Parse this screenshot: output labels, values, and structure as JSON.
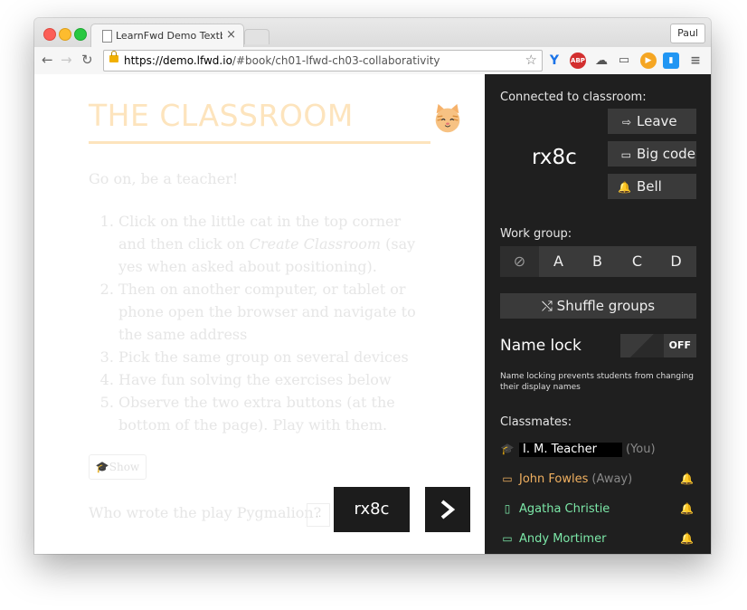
{
  "browser": {
    "tab_title": "LearnFwd Demo Textbook",
    "tab_close": "×",
    "profile_name": "Paul",
    "url_host": "https://demo.lfwd.io",
    "url_path": "/#book/ch01-lfwd-ch03-collaborativity",
    "nav_back": "←",
    "nav_forward": "→",
    "nav_reload": "↻",
    "star": "☆",
    "ext_icons": [
      "vivaldi-v-icon",
      "adblock-plus-icon",
      "cloud-upload-icon",
      "cast-icon",
      "play-icon",
      "toolbox-icon",
      "menu-icon"
    ],
    "ext_labels": {
      "v": "Y",
      "abp": "ABP",
      "cloud": "☁",
      "cast": "▭",
      "play": "▶",
      "tools": "▮",
      "menu": "≡"
    }
  },
  "page": {
    "heading": "THE CLASSROOM",
    "intro": "Go on, be a teacher!",
    "steps": [
      {
        "before": "Click on the little cat in the top corner and then click on ",
        "em": "Create Classroom",
        "after": " (say yes when asked about positioning)."
      },
      {
        "text": "Then on another computer, or tablet or phone open the browser and navigate to the same address"
      },
      {
        "text": "Pick the same group on several devices"
      },
      {
        "text": "Have fun solving the exercises below"
      },
      {
        "text": "Observe the two extra buttons (at the bottom of the page). Play with them."
      }
    ],
    "show_button": "Show",
    "question": "Who wrote the play Pygmalion?",
    "answer_placeholder": "..",
    "code_badge": "rx8c"
  },
  "panel": {
    "connected_label": "Connected to classroom:",
    "room_code": "rx8c",
    "leave_label": "Leave",
    "bigcode_label": "Big code",
    "bell_label": "Bell",
    "workgroup_label": "Work group:",
    "groups": [
      "A",
      "B",
      "C",
      "D"
    ],
    "group_none_symbol": "⊘",
    "shuffle_label": "Shuffle groups",
    "namelock_label": "Name lock",
    "namelock_state": "OFF",
    "namelock_desc": "Name locking prevents students from changing their display names",
    "classmates_label": "Classmates:",
    "me": {
      "name": "I. M. Teacher",
      "status": "(You)"
    },
    "classmates": [
      {
        "name": "John Fowles",
        "status": "(Away)",
        "color": "#f0b060",
        "device": "laptop-icon",
        "glyph": "💻"
      },
      {
        "name": "Agatha Christie",
        "status": "",
        "color": "#7ce8a8",
        "device": "phone-icon",
        "glyph": "▯"
      },
      {
        "name": "Andy Mortimer",
        "status": "",
        "color": "#7ce8a8",
        "device": "laptop-icon",
        "glyph": "💻"
      }
    ],
    "colors": {
      "accent_green": "#7ce8a8",
      "away_orange": "#f0b060",
      "panel_bg": "#1f1f1f",
      "heading_peach": "#fde4bd"
    }
  }
}
